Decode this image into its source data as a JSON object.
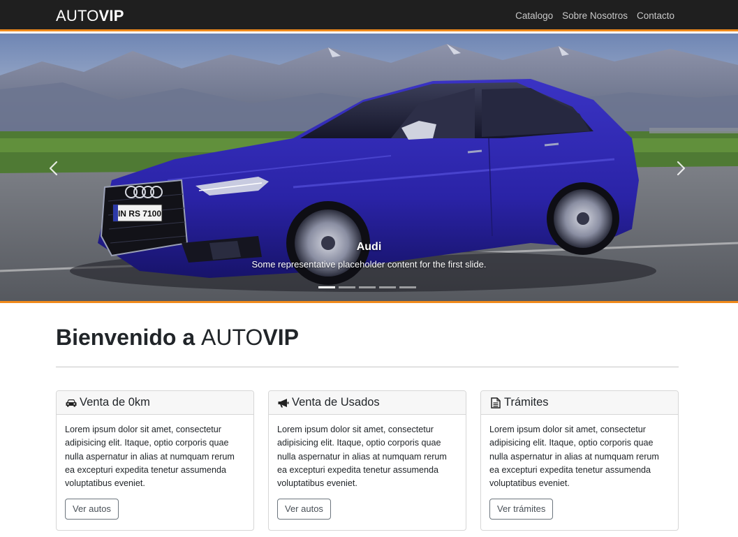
{
  "navbar": {
    "brand_light": "AUTO",
    "brand_bold": "VIP",
    "links": [
      "Catalogo",
      "Sobre Nosotros",
      "Contacto"
    ]
  },
  "carousel": {
    "slide_title": "Audi",
    "slide_text": "Some representative placeholder content for the first slide.",
    "plate_text": "IN RS 7100",
    "slide_count": 5,
    "active_slide": 1
  },
  "welcome": {
    "prefix": "Bienvenido a ",
    "brand_light": "AUTO",
    "brand_bold": "VIP"
  },
  "cards": [
    {
      "icon": "car-icon",
      "title": "Venta de 0km",
      "text": "Lorem ipsum dolor sit amet, consectetur adipisicing elit. Itaque, optio corporis quae nulla aspernatur in alias at numquam rerum ea excepturi expedita tenetur assumenda voluptatibus eveniet.",
      "button": "Ver autos"
    },
    {
      "icon": "megaphone-icon",
      "title": "Venta de Usados",
      "text": "Lorem ipsum dolor sit amet, consectetur adipisicing elit. Itaque, optio corporis quae nulla aspernatur in alias at numquam rerum ea excepturi expedita tenetur assumenda voluptatibus eveniet.",
      "button": "Ver autos"
    },
    {
      "icon": "document-icon",
      "title": "Trámites",
      "text": "Lorem ipsum dolor sit amet, consectetur adipisicing elit. Itaque, optio corporis quae nulla aspernatur in alias at numquam rerum ea excepturi expedita tenetur assumenda voluptatibus eveniet.",
      "button": "Ver trámites"
    }
  ],
  "colors": {
    "navbar_bg": "#1f1f1f",
    "accent": "#f08a1c",
    "car_body": "#2a23a6"
  }
}
